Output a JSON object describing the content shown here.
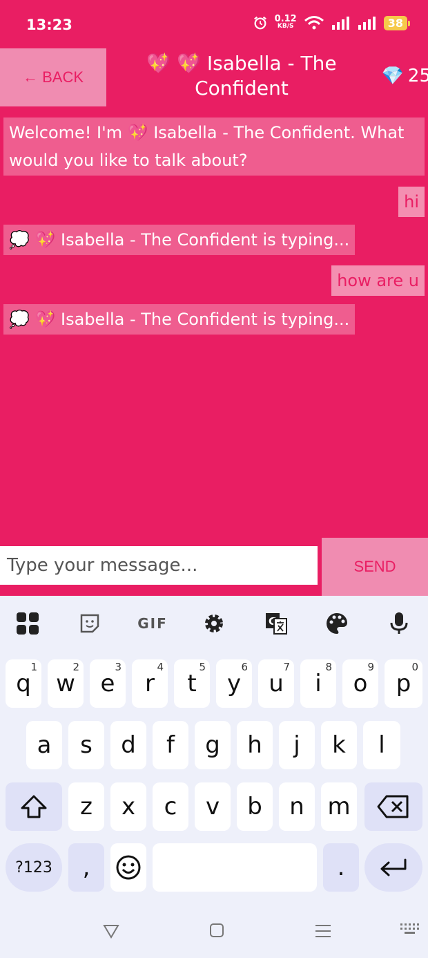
{
  "status_bar": {
    "time": "13:23",
    "speed_value": "0.12",
    "speed_unit": "KB/S",
    "battery": "38"
  },
  "header": {
    "back_label": "← BACK",
    "title": "💖 💖 Isabella - The Confident",
    "gems_icon": "💎",
    "gems": "25"
  },
  "messages": [
    {
      "from": "bot",
      "text": "Welcome! I'm 💖 Isabella - The Confident. What would you like to talk about?"
    },
    {
      "from": "user",
      "text": "hi"
    },
    {
      "from": "bot",
      "text": "💭 💖 Isabella - The Confident is typing..."
    },
    {
      "from": "user",
      "text": "how are u"
    },
    {
      "from": "bot",
      "text": "💭 💖 Isabella - The Confident is typing..."
    }
  ],
  "composer": {
    "placeholder": "Type your message...",
    "send_label": "SEND"
  },
  "keyboard": {
    "toolbar_gif": "GIF",
    "row1": [
      "q",
      "w",
      "e",
      "r",
      "t",
      "y",
      "u",
      "i",
      "o",
      "p"
    ],
    "row1_hints": [
      "1",
      "2",
      "3",
      "4",
      "5",
      "6",
      "7",
      "8",
      "9",
      "0"
    ],
    "row2": [
      "a",
      "s",
      "d",
      "f",
      "g",
      "h",
      "j",
      "k",
      "l"
    ],
    "row3": [
      "z",
      "x",
      "c",
      "v",
      "b",
      "n",
      "m"
    ],
    "symbols_label": "?123",
    "comma": ",",
    "period": "."
  },
  "colors": {
    "background": "#e91e63",
    "bot_bubble": "#ef5d8f",
    "user_bubble": "#f48fb1",
    "button": "#f08cb1"
  }
}
